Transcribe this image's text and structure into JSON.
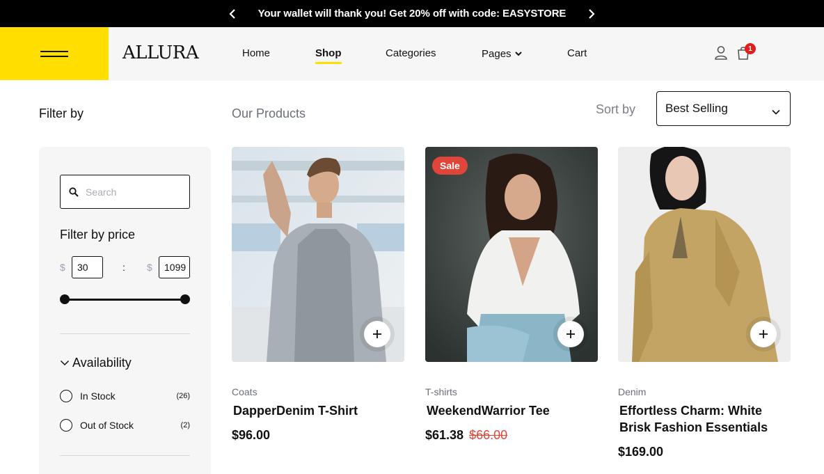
{
  "announcement": {
    "message": "Your wallet will thank you! Get 20% off with code: EASYSTORE",
    "prev_icon": "chevron-left-icon",
    "next_icon": "chevron-right-icon"
  },
  "header": {
    "logo": "ALLURA",
    "accent_color": "#ffde00",
    "nav": [
      {
        "label": "Home"
      },
      {
        "label": "Shop",
        "active": true
      },
      {
        "label": "Categories"
      },
      {
        "label": "Pages",
        "has_dropdown": true
      },
      {
        "label": "Cart"
      }
    ],
    "cart_count": "1"
  },
  "toolbar": {
    "filter_title": "Filter by",
    "products_title": "Our Products",
    "sort_label": "Sort by",
    "sort_value": "Best Selling"
  },
  "sidebar": {
    "search_placeholder": "Search",
    "price_title": "Filter by price",
    "currency": "$",
    "price_min": "30",
    "price_max": "1099",
    "separator": ":",
    "availability_title": "Availability",
    "options": [
      {
        "label": "In Stock",
        "count": "(26)"
      },
      {
        "label": "Out of Stock",
        "count": "(2)"
      }
    ]
  },
  "products": [
    {
      "category": "Coats",
      "name": "DapperDenim T-Shirt",
      "price": "$96.00",
      "old_price": "",
      "badge": ""
    },
    {
      "category": "T-shirts",
      "name": "WeekendWarrior Tee",
      "price": "$61.38",
      "old_price": "$66.00",
      "badge": "Sale"
    },
    {
      "category": "Denim",
      "name": "Effortless Charm: White Brisk Fashion Essentials",
      "price": "$169.00",
      "old_price": "",
      "badge": ""
    }
  ],
  "colors": {
    "sale": "#e0453a",
    "badge": "#e01d1d"
  }
}
